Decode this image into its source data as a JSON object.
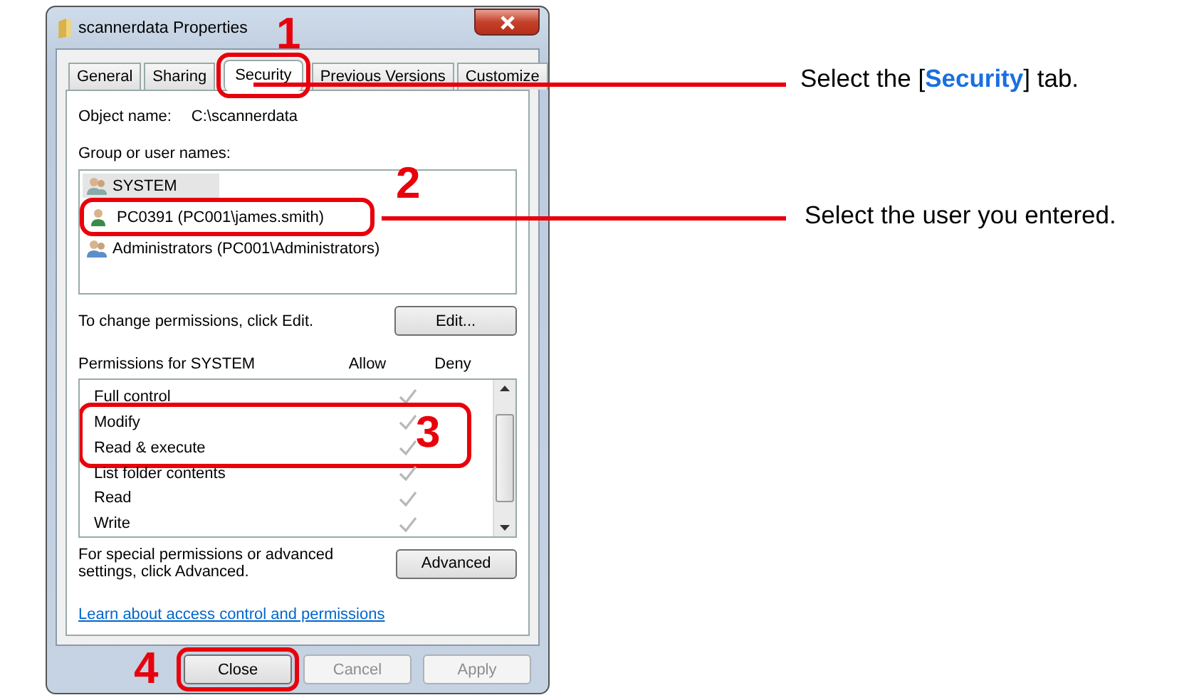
{
  "window": {
    "title": "scannerdata Properties"
  },
  "tabs": [
    {
      "label": "General",
      "selected": false
    },
    {
      "label": "Sharing",
      "selected": false
    },
    {
      "label": "Security",
      "selected": true
    },
    {
      "label": "Previous Versions",
      "selected": false
    },
    {
      "label": "Customize",
      "selected": false
    }
  ],
  "object_name": {
    "label": "Object name:",
    "value": "C:\\scannerdata"
  },
  "users": {
    "label": "Group or user names:",
    "items": [
      {
        "name": "SYSTEM",
        "selected": true
      },
      {
        "name": "PC0391 (PC001\\james.smith)",
        "selected": false
      },
      {
        "name": "Administrators (PC001\\Administrators)",
        "selected": false
      }
    ]
  },
  "change_hint": "To change permissions, click Edit.",
  "edit_button": "Edit...",
  "permissions": {
    "label": "Permissions for SYSTEM",
    "columns": [
      "Allow",
      "Deny"
    ],
    "rows": [
      {
        "name": "Full control",
        "allow": true
      },
      {
        "name": "Modify",
        "allow": true
      },
      {
        "name": "Read & execute",
        "allow": true
      },
      {
        "name": "List folder contents",
        "allow": true
      },
      {
        "name": "Read",
        "allow": true
      },
      {
        "name": "Write",
        "allow": true
      }
    ]
  },
  "advanced_hint": "For special permissions or advanced settings, click Advanced.",
  "advanced_button": "Advanced",
  "help_link": "Learn about access control and permissions",
  "buttons": [
    {
      "label": "Close",
      "disabled": false
    },
    {
      "label": "Cancel",
      "disabled": true
    },
    {
      "label": "Apply",
      "disabled": true
    }
  ],
  "callouts": [
    {
      "number": "1",
      "text": "Select the [**Security**] tab."
    },
    {
      "number": "2",
      "text": "Select the user you entered."
    },
    {
      "number": "3"
    },
    {
      "number": "4"
    }
  ]
}
